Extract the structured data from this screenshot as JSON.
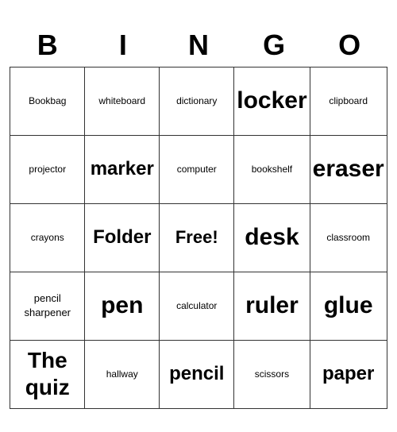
{
  "header": {
    "letters": [
      "B",
      "I",
      "N",
      "G",
      "O"
    ]
  },
  "grid": [
    [
      {
        "text": "Bookbag",
        "size": "sm"
      },
      {
        "text": "whiteboard",
        "size": "sm"
      },
      {
        "text": "dictionary",
        "size": "sm"
      },
      {
        "text": "locker",
        "size": "xl"
      },
      {
        "text": "clipboard",
        "size": "sm"
      }
    ],
    [
      {
        "text": "projector",
        "size": "sm"
      },
      {
        "text": "marker",
        "size": "lg"
      },
      {
        "text": "computer",
        "size": "sm"
      },
      {
        "text": "bookshelf",
        "size": "sm"
      },
      {
        "text": "eraser",
        "size": "xl"
      }
    ],
    [
      {
        "text": "crayons",
        "size": "sm"
      },
      {
        "text": "Folder",
        "size": "lg"
      },
      {
        "text": "Free!",
        "size": "free"
      },
      {
        "text": "desk",
        "size": "xl"
      },
      {
        "text": "classroom",
        "size": "sm"
      }
    ],
    [
      {
        "text": "pencil\nsharpener",
        "size": "multi"
      },
      {
        "text": "pen",
        "size": "xl"
      },
      {
        "text": "calculator",
        "size": "sm"
      },
      {
        "text": "ruler",
        "size": "xl"
      },
      {
        "text": "glue",
        "size": "xl"
      }
    ],
    [
      {
        "text": "The\nquiz",
        "size": "quiz"
      },
      {
        "text": "hallway",
        "size": "sm"
      },
      {
        "text": "pencil",
        "size": "lg"
      },
      {
        "text": "scissors",
        "size": "sm"
      },
      {
        "text": "paper",
        "size": "lg"
      }
    ]
  ]
}
